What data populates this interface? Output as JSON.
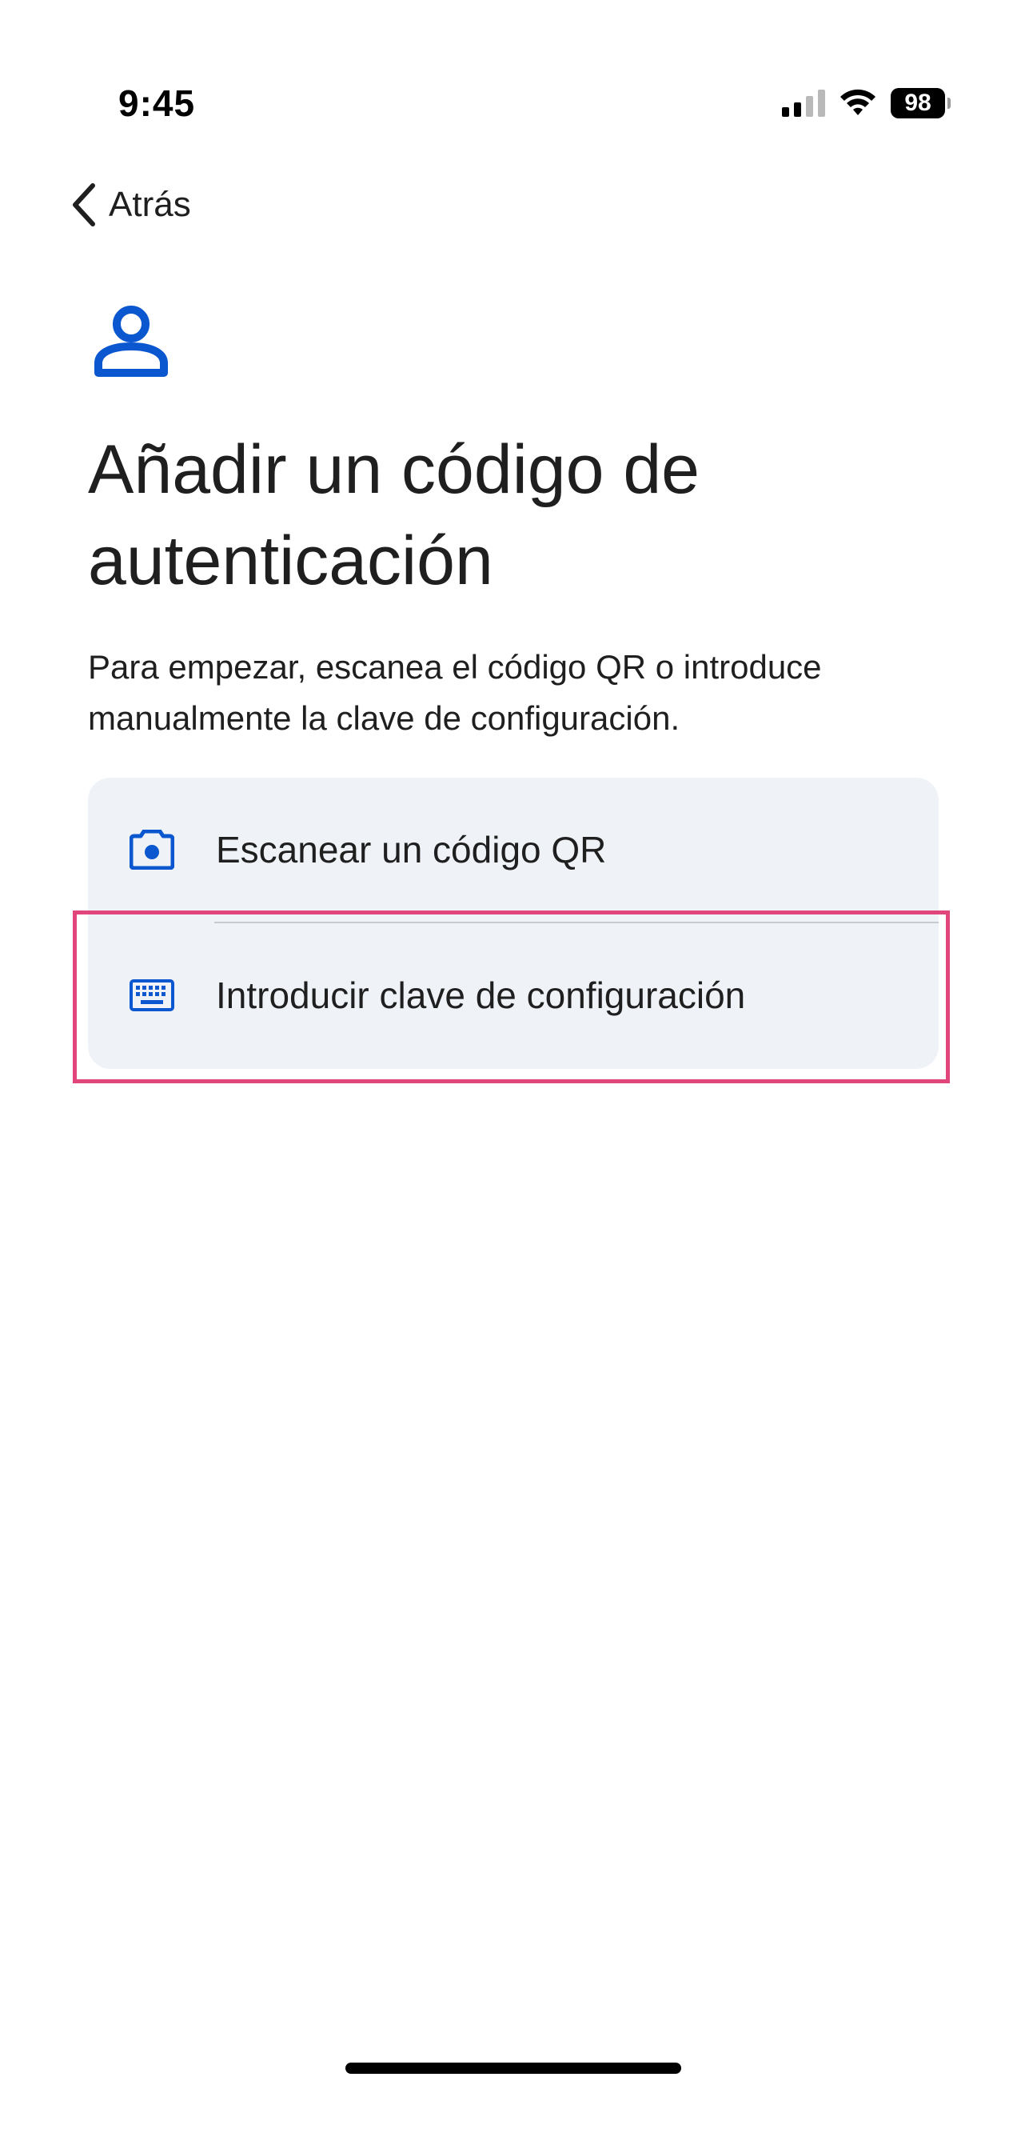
{
  "status_bar": {
    "time": "9:45",
    "battery": "98",
    "signal_icon": "cellular-signal-icon",
    "wifi_icon": "wifi-icon"
  },
  "nav": {
    "back_label": "Atrás",
    "back_icon": "chevron-left-icon"
  },
  "header": {
    "icon": "person-icon",
    "title": "Añadir un código de autenticación",
    "description": "Para empezar, escanea el código QR o introduce manualmente la clave de configuración."
  },
  "options": [
    {
      "label": "Escanear un código QR",
      "icon": "camera-icon"
    },
    {
      "label": "Introducir clave de configuración",
      "icon": "keyboard-icon"
    }
  ],
  "colors": {
    "accent": "#0b57d0",
    "card_background": "#eff3f8",
    "highlight": "#e0457b",
    "text": "#1f1f1f"
  }
}
